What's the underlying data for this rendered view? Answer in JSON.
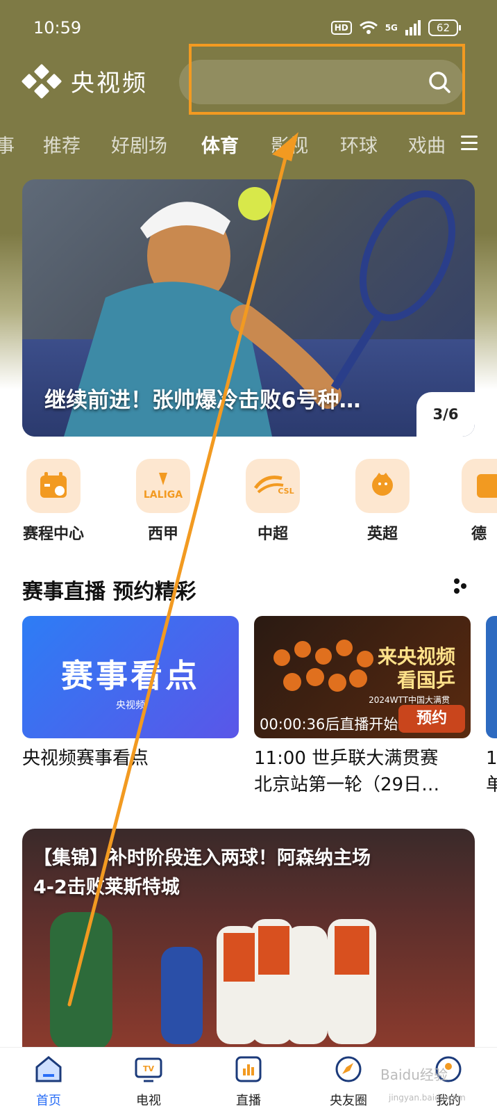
{
  "status_bar": {
    "time": "10:59",
    "hd": "HD",
    "signal": "5G",
    "battery": "62"
  },
  "header": {
    "app_name": "央视频"
  },
  "tabs": [
    "事",
    "推荐",
    "好剧场",
    "体育",
    "影视",
    "环球",
    "戏曲"
  ],
  "active_tab": "体育",
  "banner": {
    "title": "继续前进！张帅爆冷击败6号种…",
    "counter": "3/6"
  },
  "categories": [
    {
      "label": "赛程中心",
      "icon": "calendar-icon"
    },
    {
      "label": "西甲",
      "icon": "laliga-icon"
    },
    {
      "label": "中超",
      "icon": "csl-icon"
    },
    {
      "label": "英超",
      "icon": "premier-league-icon"
    },
    {
      "label": "德",
      "icon": "bundesliga-icon"
    }
  ],
  "section": {
    "title": "赛事直播 预约精彩"
  },
  "cards": [
    {
      "big_text": "赛事看点",
      "small_text": "央视频",
      "caption_line1": "央视频赛事看点",
      "caption_line2": ""
    },
    {
      "big_text_line1": "来央视频",
      "big_text_line2": "看国乒",
      "sub_text": "2024WTT中国大满贯",
      "countdown": "00:00:36后直播开始",
      "button": "预约",
      "caption_line1": "11:00 世乒联大满贯赛",
      "caption_line2": "北京站第一轮（29日…"
    },
    {
      "caption_line1": "1",
      "caption_line2": "单"
    }
  ],
  "video": {
    "title_line1": "【集锦】补时阶段连入两球！阿森纳主场",
    "title_line2": "4-2击败莱斯特城"
  },
  "bottom_nav": [
    {
      "label": "首页",
      "icon": "home-icon",
      "active": true
    },
    {
      "label": "电视",
      "icon": "tv-icon",
      "active": false
    },
    {
      "label": "直播",
      "icon": "live-icon",
      "active": false
    },
    {
      "label": "央友圈",
      "icon": "compass-icon",
      "active": false
    },
    {
      "label": "我的",
      "icon": "profile-icon",
      "active": false
    }
  ],
  "watermark": {
    "text": "Baidu经验",
    "sub": "jingyan.baidu.com"
  },
  "colors": {
    "header_bg": "#7e7a45",
    "highlight": "#f29a21",
    "accent_blue": "#2a6ef6"
  }
}
